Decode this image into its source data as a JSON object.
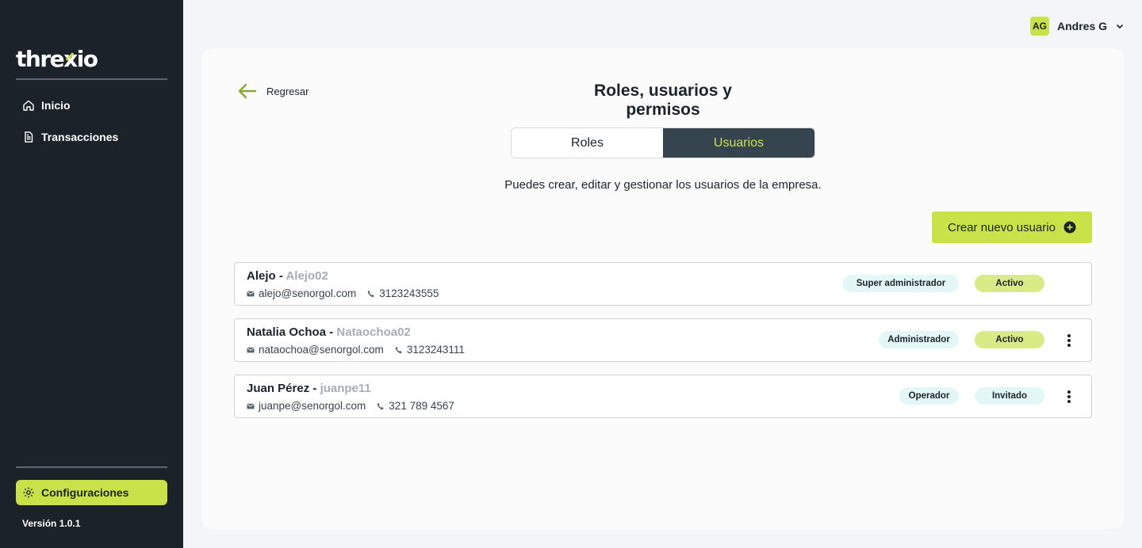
{
  "brand": {
    "logo_a": "thre",
    "logo_x": "x",
    "logo_b": "io"
  },
  "sidebar": {
    "items": [
      {
        "label": "Inicio",
        "icon": "home-icon"
      },
      {
        "label": "Transacciones",
        "icon": "document-icon"
      }
    ],
    "settings_label": "Configuraciones",
    "version": "Versión 1.0.1"
  },
  "header": {
    "user_initials": "AG",
    "user_name": "Andres G"
  },
  "page": {
    "back_label": "Regresar",
    "title": "Roles, usuarios y permisos",
    "tabs": [
      {
        "label": "Roles"
      },
      {
        "label": "Usuarios"
      }
    ],
    "active_tab": "Usuarios",
    "subtitle": "Puedes crear, editar y gestionar los usuarios de la empresa.",
    "create_button": "Crear nuevo usuario"
  },
  "users": [
    {
      "name": "Alejo",
      "sep": " - ",
      "handle": "Alejo02",
      "email": "alejo@senorgol.com",
      "phone": "3123243555",
      "role": "Super administrador",
      "status": "Activo",
      "has_menu": false
    },
    {
      "name": "Natalia Ochoa",
      "sep": " - ",
      "handle": "Nataochoa02",
      "email": "nataochoa@senorgol.com",
      "phone": "3123243111",
      "role": "Administrador",
      "status": "Activo",
      "has_menu": true
    },
    {
      "name": "Juan Pérez",
      "sep": " - ",
      "handle": "juanpe11",
      "email": "juanpe@senorgol.com",
      "phone": "321 789 4567",
      "role": "Operador",
      "status": "Invitado",
      "has_menu": true
    }
  ],
  "colors": {
    "accent": "#c9e24a",
    "sidebar": "#1b222a",
    "tab_active": "#36444f"
  }
}
